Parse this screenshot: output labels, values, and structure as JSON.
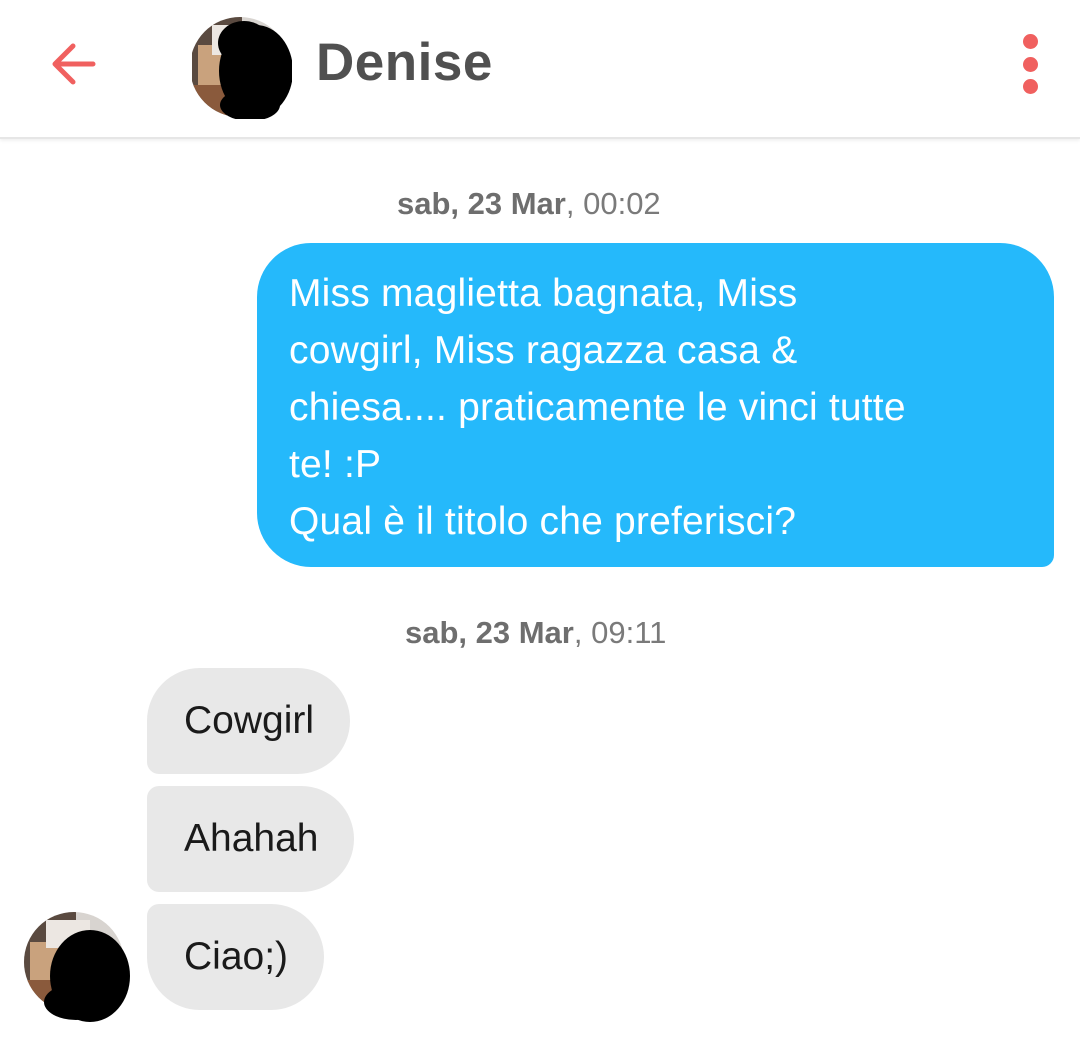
{
  "header": {
    "back_icon": "arrow-left-icon",
    "contact_name": "Denise",
    "menu_icon": "more-vertical-icon",
    "accent_color": "#f0605f"
  },
  "conversation": {
    "timestamps": [
      {
        "day": "sab, 23 Mar",
        "time": ", 00:02"
      },
      {
        "day": "sab, 23 Mar",
        "time": ", 09:11"
      }
    ],
    "outgoing": [
      {
        "text": "Miss maglietta bagnata, Miss\ncowgirl, Miss ragazza casa &\nchiesa.... praticamente le vinci tutte\nte! :P\nQual è il titolo che preferisci?",
        "color": "#25b9fb"
      }
    ],
    "incoming": [
      {
        "text": "Cowgirl"
      },
      {
        "text": "Ahahah"
      },
      {
        "text": "Ciao;)"
      }
    ],
    "incoming_color": "#e8e8e8"
  }
}
